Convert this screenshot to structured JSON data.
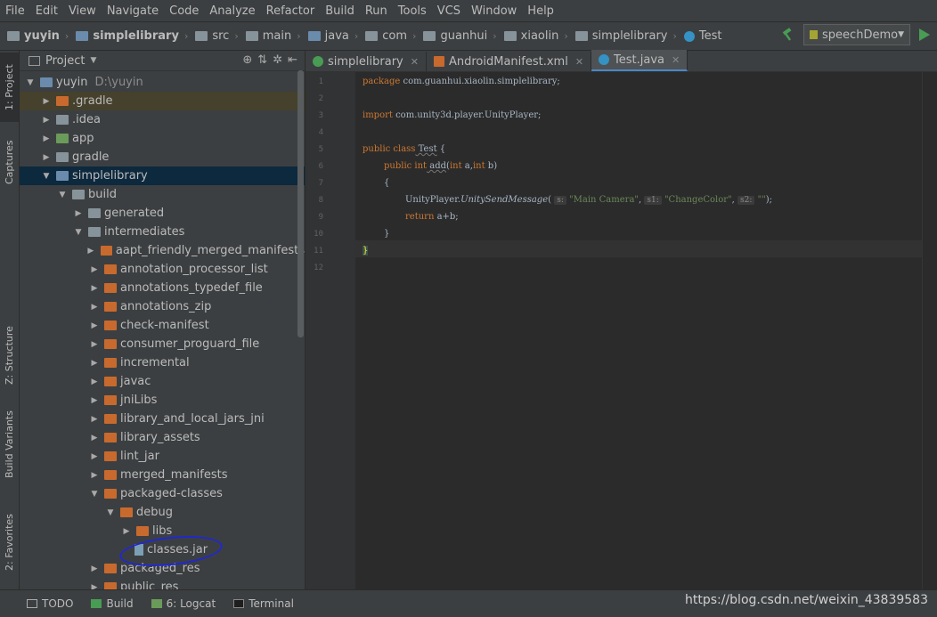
{
  "menu": [
    "File",
    "Edit",
    "View",
    "Navigate",
    "Code",
    "Analyze",
    "Refactor",
    "Build",
    "Run",
    "Tools",
    "VCS",
    "Window",
    "Help"
  ],
  "breadcrumb": [
    "yuyin",
    "simplelibrary",
    "src",
    "main",
    "java",
    "com",
    "guanhui",
    "xiaolin",
    "simplelibrary",
    "Test"
  ],
  "run_config": "speechDemo",
  "project_panel": {
    "title": "Project"
  },
  "side_tabs": {
    "project": "1: Project",
    "captures": "Captures",
    "structure": "Z: Structure",
    "build_variants": "Build Variants",
    "favorites": "2: Favorites"
  },
  "tree": [
    {
      "label": "yuyin",
      "extra": "D:\\yuyin"
    },
    {
      "label": ".gradle"
    },
    {
      "label": ".idea"
    },
    {
      "label": "app"
    },
    {
      "label": "gradle"
    },
    {
      "label": "simplelibrary"
    },
    {
      "label": "build"
    },
    {
      "label": "generated"
    },
    {
      "label": "intermediates"
    },
    {
      "label": "aapt_friendly_merged_manifests"
    },
    {
      "label": "annotation_processor_list"
    },
    {
      "label": "annotations_typedef_file"
    },
    {
      "label": "annotations_zip"
    },
    {
      "label": "check-manifest"
    },
    {
      "label": "consumer_proguard_file"
    },
    {
      "label": "incremental"
    },
    {
      "label": "javac"
    },
    {
      "label": "jniLibs"
    },
    {
      "label": "library_and_local_jars_jni"
    },
    {
      "label": "library_assets"
    },
    {
      "label": "lint_jar"
    },
    {
      "label": "merged_manifests"
    },
    {
      "label": "packaged-classes"
    },
    {
      "label": "debug"
    },
    {
      "label": "libs"
    },
    {
      "label": "classes.jar"
    },
    {
      "label": "packaged_res"
    },
    {
      "label": "public_res"
    }
  ],
  "tabs": [
    "simplelibrary",
    "AndroidManifest.xml",
    "Test.java"
  ],
  "code": {
    "line_numbers": [
      "1",
      "2",
      "3",
      "4",
      "5",
      "6",
      "7",
      "8",
      "9",
      "10",
      "11",
      "12"
    ],
    "l1_kw": "package",
    "l1_rest": " com.guanhui.xiaolin.simplelibrary;",
    "l3_kw": "import",
    "l3_rest": " com.unity3d.player.UnityPlayer;",
    "l5_kw": "public class",
    "l5_name": " Test",
    "l5_rest": " {",
    "l6_kw": "public int",
    "l6_name": " add",
    "l6_p1": "(",
    "l6_kw2": "int",
    "l6_p2": " a,",
    "l6_kw3": "int",
    "l6_p3": " b)",
    "l7": "{",
    "l8_a": "UnityPlayer.",
    "l8_m": "UnitySendMessage",
    "l8_b": "( ",
    "l8_h1": "s:",
    "l8_s1": " \"Main Camera\"",
    ", ": "",
    "l8_h2": "s1:",
    "l8_s2": " \"ChangeColor\"",
    "l8_h3": "s2:",
    "l8_s3": " \"\"",
    "l8_end": ");",
    "l9_kw": "return",
    "l9_rest": " a+b;",
    "l10": "}",
    "l11": "}"
  },
  "status": {
    "todo": "TODO",
    "build": "Build",
    "logcat": "6: Logcat",
    "terminal": "Terminal"
  },
  "watermark": "https://blog.csdn.net/weixin_43839583"
}
